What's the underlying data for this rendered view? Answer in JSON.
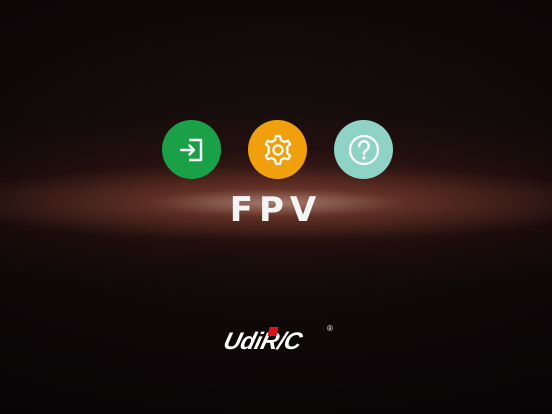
{
  "app": {
    "title": "FPV"
  },
  "buttons": {
    "enter": {
      "icon": "sign-in-icon",
      "color": "#1aa147"
    },
    "settings": {
      "icon": "gear-icon",
      "color": "#f0a00c"
    },
    "help": {
      "icon": "question-icon",
      "color": "#8fd2c6"
    }
  },
  "brand": {
    "logo": "UdiR/C",
    "registered_mark": "®",
    "logo_accent_color": "#d8141c"
  }
}
